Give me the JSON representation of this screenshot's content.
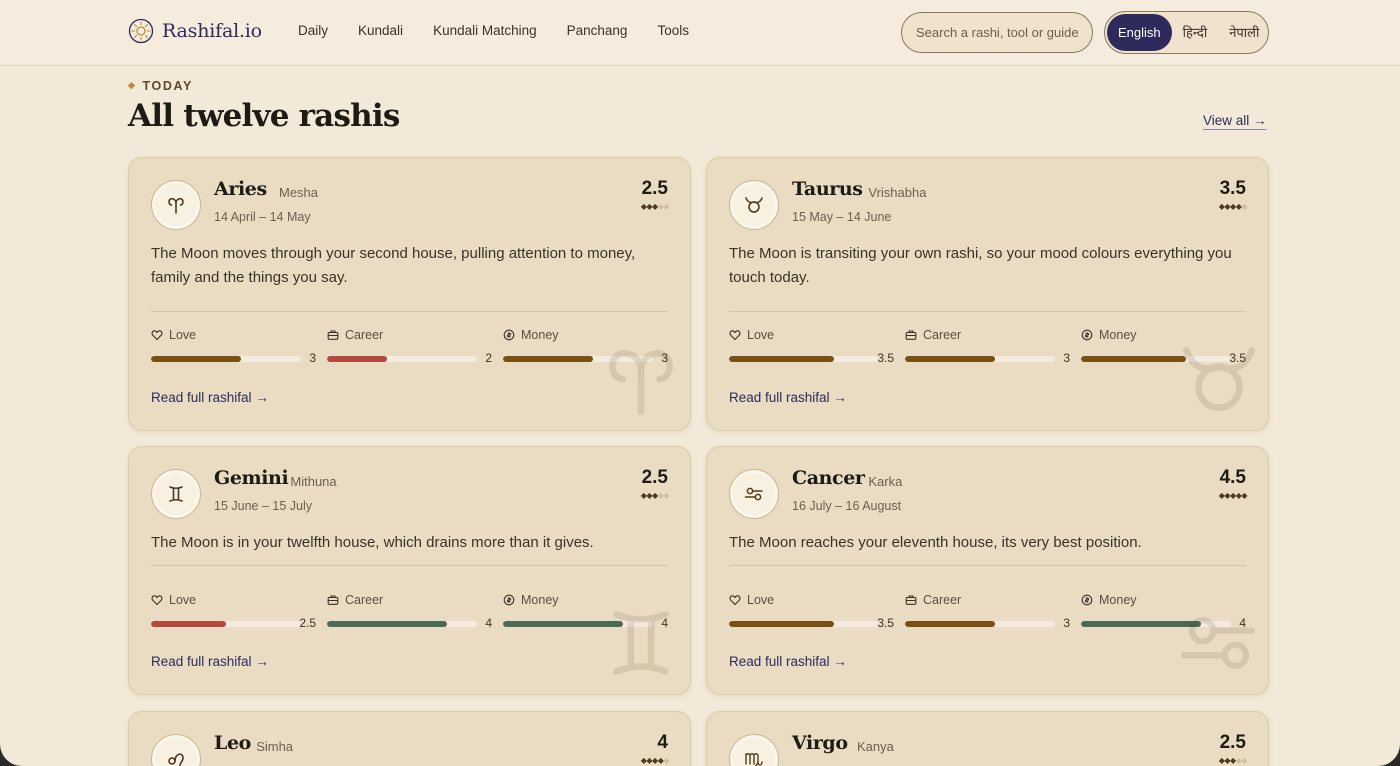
{
  "brand": {
    "name": "Rashifal.io"
  },
  "nav": [
    "Daily",
    "Kundali",
    "Kundali Matching",
    "Panchang",
    "Tools"
  ],
  "search": {
    "placeholder": "Search a rashi, tool or guide"
  },
  "languages": [
    {
      "label": "English",
      "active": true
    },
    {
      "label": "हिन्दी",
      "active": false
    },
    {
      "label": "नेपाली",
      "active": false
    }
  ],
  "section": {
    "eyebrow": "TODAY",
    "title": "All twelve rashis",
    "view_all": "View all →"
  },
  "metric_labels": {
    "love": "Love",
    "career": "Career",
    "money": "Money"
  },
  "read_more": "Read full rashifal →",
  "colors": {
    "brown": "#7a4f14",
    "red": "#b3483e",
    "green": "#4a6b4e",
    "accent_navy": "#2e2a5c"
  },
  "cards": [
    {
      "name": "Aries",
      "alt": "Mesha",
      "dates": "14 April – 14 May",
      "score": "2.5",
      "stars": 2.5,
      "icon": "aries-icon",
      "text": "The Moon moves through your second house, pulling attention to money, family and the things you say.",
      "metrics": [
        {
          "value": "3",
          "fraction": 0.6,
          "color": "brown"
        },
        {
          "value": "2",
          "fraction": 0.4,
          "color": "red"
        },
        {
          "value": "3",
          "fraction": 0.6,
          "color": "brown"
        }
      ]
    },
    {
      "name": "Taurus",
      "alt": "Vrishabha",
      "dates": "15 May – 14 June",
      "score": "3.5",
      "stars": 3.5,
      "icon": "taurus-icon",
      "text": "The Moon is transiting your own rashi, so your mood colours everything you touch today.",
      "metrics": [
        {
          "value": "3.5",
          "fraction": 0.7,
          "color": "brown"
        },
        {
          "value": "3",
          "fraction": 0.6,
          "color": "brown"
        },
        {
          "value": "3.5",
          "fraction": 0.7,
          "color": "brown"
        }
      ]
    },
    {
      "name": "Gemini",
      "alt": "Mithuna",
      "dates": "15 June – 15 July",
      "score": "2.5",
      "stars": 2.5,
      "icon": "gemini-icon",
      "text": "The Moon is in your twelfth house, which drains more than it gives.",
      "metrics": [
        {
          "value": "2.5",
          "fraction": 0.5,
          "color": "red"
        },
        {
          "value": "4",
          "fraction": 0.8,
          "color": "green"
        },
        {
          "value": "4",
          "fraction": 0.8,
          "color": "green"
        }
      ]
    },
    {
      "name": "Cancer",
      "alt": "Karka",
      "dates": "16 July – 16 August",
      "score": "4.5",
      "stars": 4.5,
      "icon": "cancer-icon",
      "text": "The Moon reaches your eleventh house, its very best position.",
      "metrics": [
        {
          "value": "3.5",
          "fraction": 0.7,
          "color": "brown"
        },
        {
          "value": "3",
          "fraction": 0.6,
          "color": "brown"
        },
        {
          "value": "4",
          "fraction": 0.8,
          "color": "green"
        }
      ]
    },
    {
      "name": "Leo",
      "alt": "Simha",
      "dates": "",
      "score": "4",
      "stars": 4,
      "icon": "leo-icon",
      "text": "",
      "metrics": []
    },
    {
      "name": "Virgo",
      "alt": "Kanya",
      "dates": "",
      "score": "2.5",
      "stars": 2.5,
      "icon": "virgo-icon",
      "text": "",
      "metrics": []
    }
  ]
}
